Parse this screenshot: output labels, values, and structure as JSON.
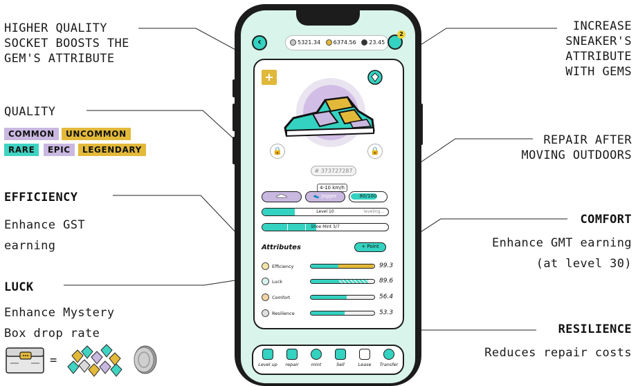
{
  "annotations": {
    "socket": [
      "HIGHER QUALITY",
      "SOCKET BOOSTS THE",
      "GEM'S ATTRIBUTE"
    ],
    "quality_title": "QUALITY",
    "quality_tags": [
      {
        "label": "COMMON",
        "color": "#c9b8e0"
      },
      {
        "label": "UNCOMMON",
        "color": "#e3b93a"
      },
      {
        "label": "RARE",
        "color": "#3fd3c2"
      },
      {
        "label": "EPIC",
        "color": "#c9b8e0"
      },
      {
        "label": "LEGENDARY",
        "color": "#e3b93a"
      }
    ],
    "efficiency": {
      "title": "EFFICIENCY",
      "lines": [
        "Enhance GST",
        "earning"
      ]
    },
    "luck": {
      "title": "LUCK",
      "lines": [
        "Enhance Mystery",
        "Box drop rate"
      ]
    },
    "equals": "=",
    "increase": [
      "INCREASE",
      "SNEAKER'S",
      "ATTRIBUTE",
      "WITH GEMS"
    ],
    "repair": [
      "REPAIR AFTER",
      "MOVING OUTDOORS"
    ],
    "comfort": {
      "title": "COMFORT",
      "lines": [
        "Enhance GMT earning",
        "(at level 30)"
      ]
    },
    "resilience": {
      "title": "RESILIENCE",
      "lines": [
        "Reduces repair costs"
      ]
    }
  },
  "app": {
    "balances": [
      "5321.34",
      "6374.56",
      "23.45"
    ],
    "wallet_badge": "2",
    "sneaker_id": "373727287",
    "speed_range": "4-10 km/h",
    "type_label": "Jogger",
    "durability": "80/100",
    "level": "Level 10",
    "level_action": "leveling...",
    "shoe_mint": "Shoe Mint 3/7",
    "attributes_title": "Attributes",
    "point_label": "Point",
    "attributes": [
      {
        "name": "Efficiency",
        "value": "99.3",
        "fraction": 0.99
      },
      {
        "name": "Luck",
        "value": "89.6",
        "fraction": 0.9
      },
      {
        "name": "Comfort",
        "value": "56.4",
        "fraction": 0.56
      },
      {
        "name": "Resilience",
        "value": "53.3",
        "fraction": 0.53
      }
    ],
    "tabs": [
      "Level up",
      "repair",
      "mint",
      "Sell",
      "Lease",
      "Transfer"
    ]
  },
  "colors": {
    "teal": "#34d2c0",
    "gold": "#e3b93a",
    "lilac": "#c9b8e0"
  }
}
